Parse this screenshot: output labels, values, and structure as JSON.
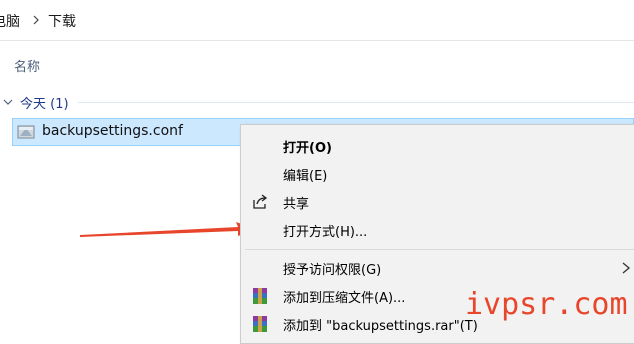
{
  "breadcrumb": {
    "parent": "电脑",
    "current": "下载"
  },
  "column_header": "名称",
  "group": {
    "label": "今天 (1)"
  },
  "file": {
    "name": "backupsettings.conf"
  },
  "context_menu": {
    "items": [
      {
        "label": "打开(O)",
        "bold": true,
        "icon": ""
      },
      {
        "label": "编辑(E)",
        "icon": ""
      },
      {
        "label": "共享",
        "icon": "share-icon"
      },
      {
        "label": "打开方式(H)...",
        "icon": ""
      },
      {
        "label": "授予访问权限(G)",
        "icon": "",
        "submenu": true
      },
      {
        "label": "添加到压缩文件(A)...",
        "icon": "winrar-icon"
      },
      {
        "label": "添加到 \"backupsettings.rar\"(T)",
        "icon": "winrar-icon"
      }
    ]
  },
  "watermark": "ivpsr.com",
  "colors": {
    "selection": "#cce8ff",
    "selection_border": "#99d1ff",
    "menu_bg": "#f2f2f2",
    "annotation_red": "#e8462b"
  }
}
